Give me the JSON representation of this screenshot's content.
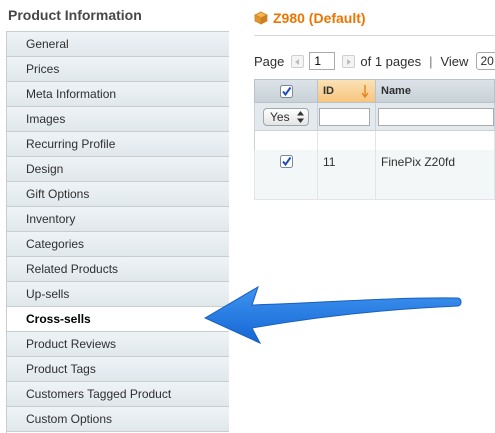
{
  "sidebar": {
    "title": "Product Information",
    "items": [
      {
        "label": "General"
      },
      {
        "label": "Prices"
      },
      {
        "label": "Meta Information"
      },
      {
        "label": "Images"
      },
      {
        "label": "Recurring Profile"
      },
      {
        "label": "Design"
      },
      {
        "label": "Gift Options"
      },
      {
        "label": "Inventory"
      },
      {
        "label": "Categories"
      },
      {
        "label": "Related Products"
      },
      {
        "label": "Up-sells"
      },
      {
        "label": "Cross-sells"
      },
      {
        "label": "Product Reviews"
      },
      {
        "label": "Product Tags"
      },
      {
        "label": "Customers Tagged Product"
      },
      {
        "label": "Custom Options"
      }
    ],
    "active_item": "Cross-sells"
  },
  "product": {
    "title": "Z980 (Default)",
    "icon": "box-icon",
    "accent_color": "#ea7601"
  },
  "pager": {
    "page_label": "Page",
    "page_value": "1",
    "pages_text": "of 1 pages",
    "separator": "|",
    "view_label": "View",
    "view_value": "20"
  },
  "grid": {
    "columns": [
      {
        "label": "",
        "icon": "checkbox-icon"
      },
      {
        "label": "ID",
        "sorted": "descending"
      },
      {
        "label": "Name"
      }
    ],
    "filter": {
      "select_value": "Yes",
      "id_value": "",
      "name_value": ""
    },
    "rows": [
      {
        "checked": true,
        "id": "11",
        "name": "FinePix Z20fd"
      }
    ]
  },
  "annotation": {
    "arrow_color": "#1e7be3",
    "points_to": "Cross-sells"
  }
}
